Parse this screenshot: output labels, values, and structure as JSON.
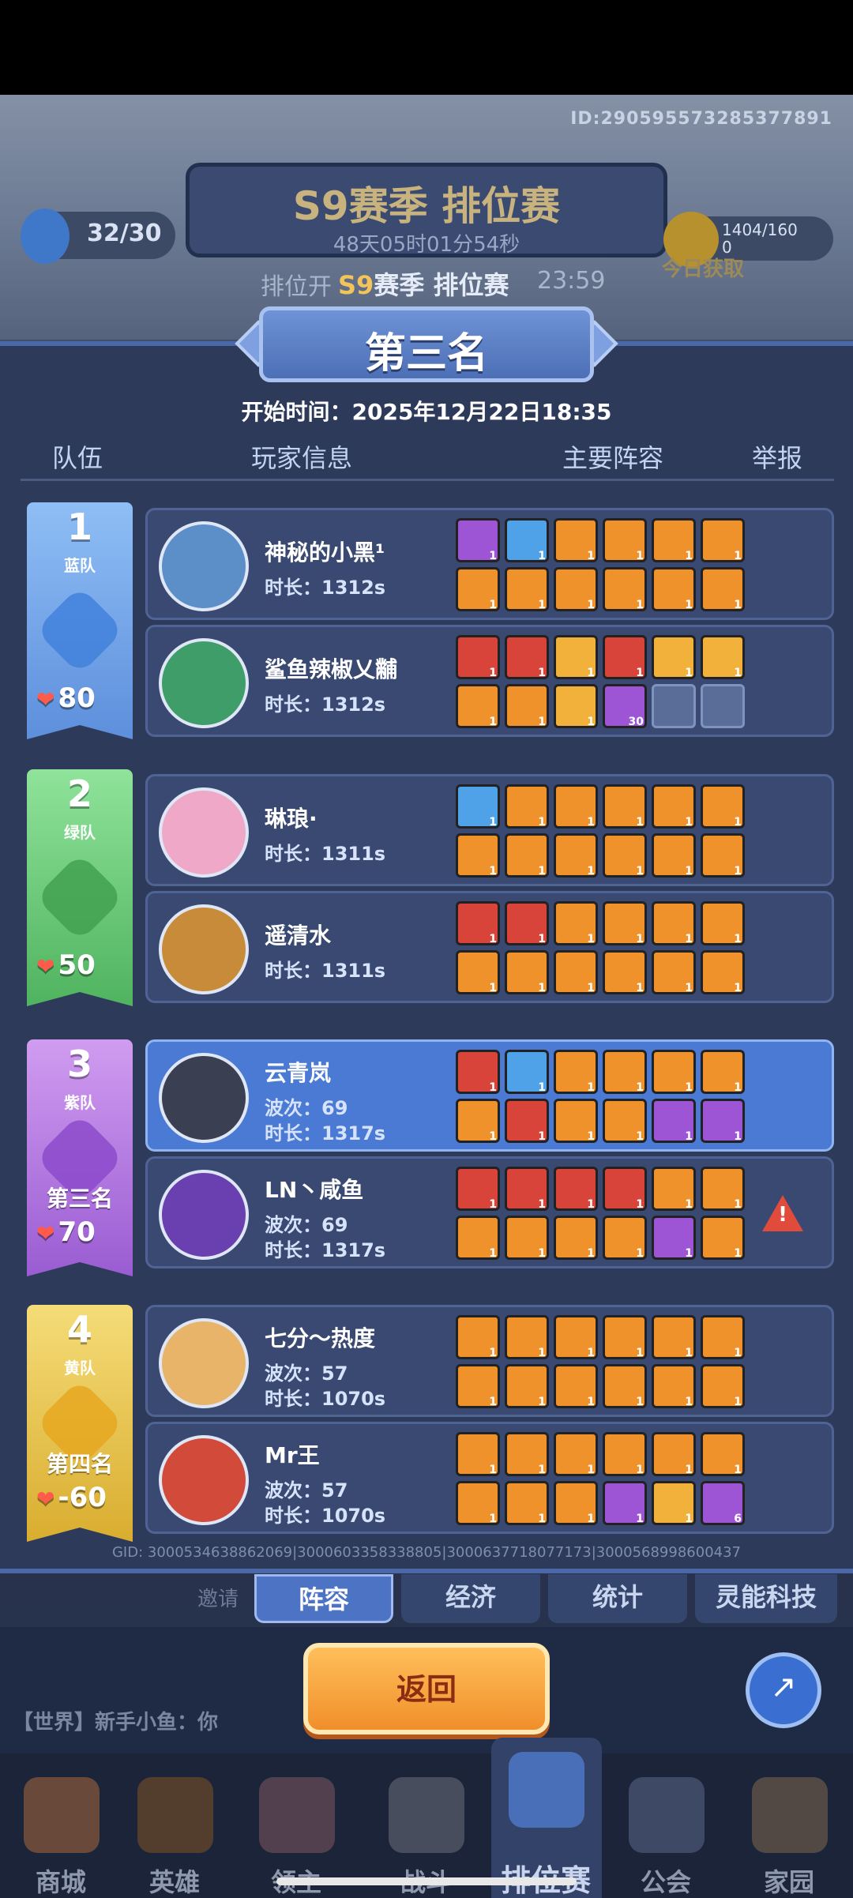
{
  "header": {
    "uid": "ID:2905955732853778​91",
    "season_title": "S9赛季 排位赛",
    "season_timer": "48天05时01分54秒",
    "stamina": "32/30",
    "coin": "1404/160\n0",
    "today_gain": "今日获取",
    "sub_title_s9": "S9",
    "sub_title_rest": "赛季 排位赛",
    "sub_left": "排位开",
    "sub_right": "23:59"
  },
  "result": {
    "rank_title": "第三名",
    "start_time": "开始时间：2025年12月22日18:35"
  },
  "columns": {
    "team": "队伍",
    "player": "玩家信息",
    "lineup": "主要阵容",
    "report": "举报"
  },
  "teams": [
    {
      "num": "1",
      "name": "蓝队",
      "place": "",
      "score": "80",
      "color": "#7fb0f0"
    },
    {
      "num": "2",
      "name": "绿队",
      "place": "",
      "score": "50",
      "color": "#7dd88a"
    },
    {
      "num": "3",
      "name": "紫队",
      "place": "第三名",
      "score": "70",
      "color": "#c28ae8"
    },
    {
      "num": "4",
      "name": "黄队",
      "place": "第四名",
      "score": "-60",
      "color": "#f0cf5a"
    }
  ],
  "players": [
    {
      "name": "神秘的小黑¹",
      "waves": "",
      "duration": "时长：1312s"
    },
    {
      "name": "鲨鱼辣椒乂黼",
      "waves": "",
      "duration": "时长：1312s"
    },
    {
      "name": "琳琅·",
      "waves": "",
      "duration": "时长：1311s"
    },
    {
      "name": "遥清水",
      "waves": "",
      "duration": "时长：1311s"
    },
    {
      "name": "云青岚",
      "waves": "波次：69",
      "duration": "时长：1317s"
    },
    {
      "name": "LN丶咸鱼",
      "waves": "波次：69",
      "duration": "时长：1317s"
    },
    {
      "name": "七分～热度",
      "waves": "波次：57",
      "duration": "时长：1070s"
    },
    {
      "name": "Mr王",
      "waves": "波次：57",
      "duration": "时长：1070s"
    }
  ],
  "lineups": [
    [
      "1",
      "1",
      "1",
      "1",
      "1",
      "1",
      "1",
      "1",
      "1",
      "1",
      "1",
      "1"
    ],
    [
      "1",
      "1",
      "1",
      "1",
      "1",
      "1",
      "1",
      "1",
      "1",
      "30",
      "",
      ""
    ],
    [
      "1",
      "1",
      "1",
      "1",
      "1",
      "1",
      "1",
      "1",
      "1",
      "1",
      "1",
      "1"
    ],
    [
      "1",
      "1",
      "1",
      "1",
      "1",
      "1",
      "1",
      "1",
      "1",
      "1",
      "1",
      "1"
    ],
    [
      "1",
      "1",
      "1",
      "1",
      "1",
      "1",
      "1",
      "1",
      "1",
      "1",
      "1",
      "1"
    ],
    [
      "1",
      "1",
      "1",
      "1",
      "1",
      "1",
      "1",
      "1",
      "1",
      "1",
      "1",
      "1"
    ],
    [
      "1",
      "1",
      "1",
      "1",
      "1",
      "1",
      "1",
      "1",
      "1",
      "1",
      "1",
      "1"
    ],
    [
      "1",
      "1",
      "1",
      "1",
      "1",
      "1",
      "1",
      "1",
      "1",
      "1",
      "1",
      "6"
    ]
  ],
  "gid": "GID: 3000534638862069|3000603358338805|3000637718077173|3000568998600437",
  "tabs": [
    "阵容",
    "经济",
    "统计",
    "灵能科技"
  ],
  "back_button": "返回",
  "invite": "邀请",
  "world_chat": "【世界】新手小鱼：你",
  "nav": [
    "商城",
    "英雄",
    "领主",
    "战斗",
    "排位赛",
    "公会",
    "家园"
  ]
}
